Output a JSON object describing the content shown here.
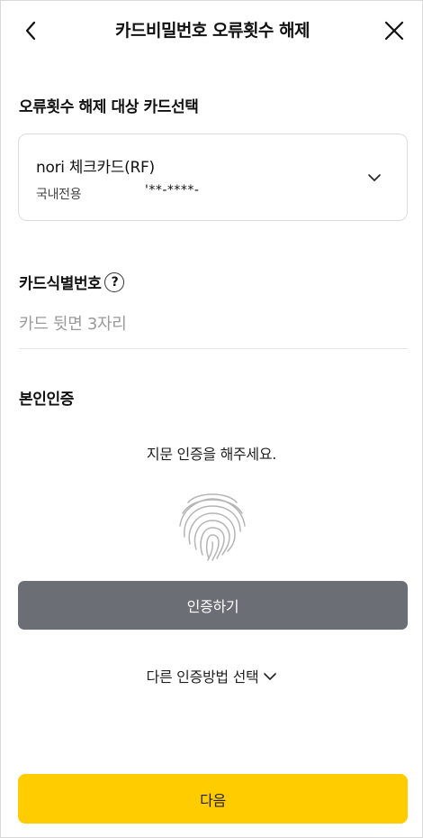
{
  "header": {
    "title": "카드비밀번호 오류횟수 해제",
    "back_icon": "chevron-left-icon",
    "close_icon": "close-icon"
  },
  "card_section": {
    "label": "오류횟수 해제 대상 카드선택",
    "card_name": "nori 체크카드(RF)",
    "card_type": "국내전용",
    "card_number": "'**-****-",
    "dropdown_icon": "chevron-down-icon"
  },
  "card_id": {
    "label": "카드식별번호",
    "help_glyph": "?",
    "placeholder": "카드 뒷면 3자리",
    "value": ""
  },
  "auth": {
    "label": "본인인증",
    "message": "지문 인증을 해주세요.",
    "fingerprint_icon": "fingerprint-icon",
    "auth_button": "인증하기",
    "other_method": "다른 인증방법 선택"
  },
  "footer": {
    "next_button": "다음"
  },
  "colors": {
    "primary_yellow": "#ffcc00",
    "auth_button_gray": "#6b6e75",
    "border": "#dcdcdc"
  }
}
